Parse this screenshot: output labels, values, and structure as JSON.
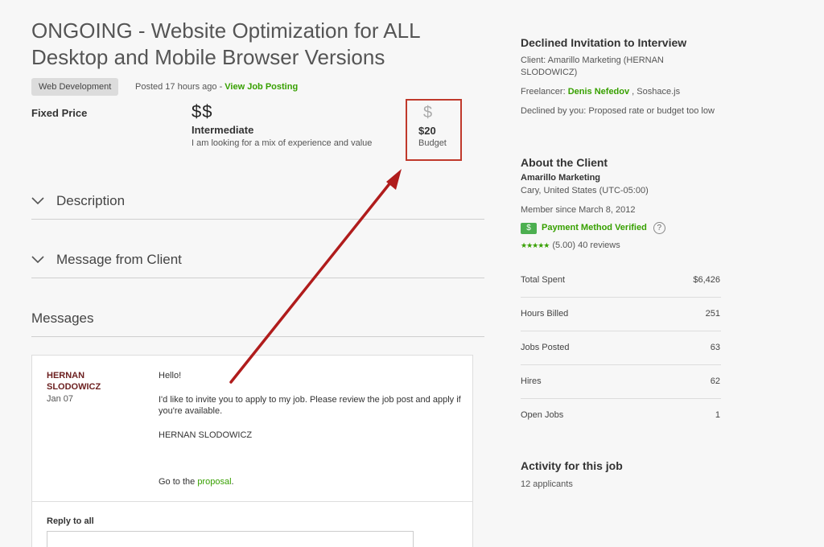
{
  "job": {
    "title": "ONGOING - Website Optimization for ALL Desktop and Mobile Browser Versions",
    "category": "Web Development",
    "posted": "Posted 17 hours ago - ",
    "view_link": "View Job Posting",
    "price_type": "Fixed Price",
    "level_icon": "$$",
    "level_name": "Intermediate",
    "level_desc": "I am looking for a mix of experience and value",
    "budget_icon": "$",
    "budget_value": "$20",
    "budget_label": "Budget"
  },
  "sections": {
    "description": "Description",
    "message_from_client": "Message from Client",
    "messages": "Messages"
  },
  "message": {
    "sender": "HERNAN SLODOWICZ",
    "date": "Jan 07",
    "greeting": "Hello!",
    "body": "I'd like to invite you to apply to my job. Please review the job post and apply if you're available.",
    "signature": "HERNAN SLODOWICZ",
    "go_to_prefix": "Go to the ",
    "go_to_link": "proposal",
    "go_to_suffix": ".",
    "reply_label": "Reply to all"
  },
  "sidebar": {
    "declined_title": "Declined Invitation to Interview",
    "client_line": "Client: Amarillo Marketing (HERNAN SLODOWICZ)",
    "freelancer_prefix": "Freelancer: ",
    "freelancer_name": "Denis Nefedov",
    "freelancer_suffix": " , Soshace.js",
    "declined_reason": "Declined by you: Proposed rate or budget too low",
    "about_title": "About the Client",
    "client_name": "Amarillo Marketing",
    "client_location": "Cary, United States (UTC-05:00)",
    "member_since": "Member since March 8, 2012",
    "payment_badge": "$",
    "payment_verified": "Payment Method Verified",
    "help_icon": "?",
    "stars": "★★★★★",
    "rating": "(5.00) 40 reviews",
    "stats": [
      {
        "label": "Total Spent",
        "value": "$6,426"
      },
      {
        "label": "Hours Billed",
        "value": "251"
      },
      {
        "label": "Jobs Posted",
        "value": "63"
      },
      {
        "label": "Hires",
        "value": "62"
      },
      {
        "label": "Open Jobs",
        "value": "1"
      }
    ],
    "activity_title": "Activity for this job",
    "applicants": "12 applicants"
  },
  "colors": {
    "accent_green": "#37a000",
    "annotation_red": "#c0392b",
    "sender_maroon": "#6b1e1e"
  },
  "icons": [
    "chevron-down-icon",
    "dollar-icon",
    "help-circle-icon",
    "star-icon",
    "arrow-annotation"
  ]
}
